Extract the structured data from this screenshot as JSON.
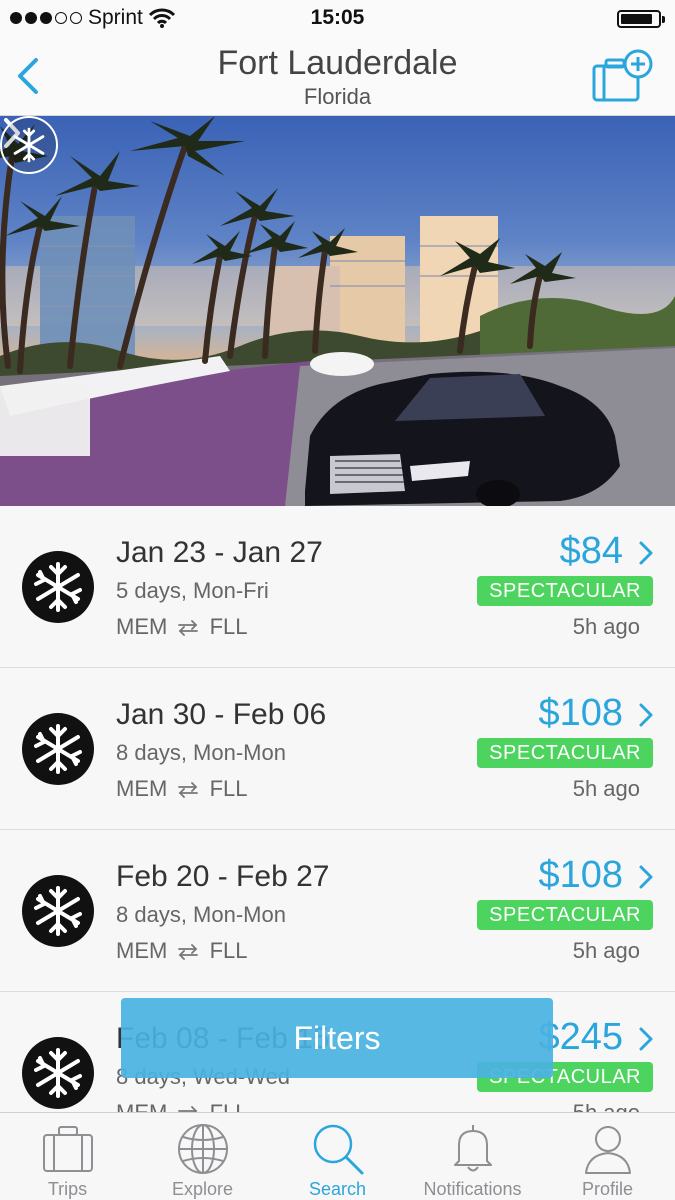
{
  "status_bar": {
    "carrier": "Sprint",
    "signal_bars_filled": 3,
    "signal_bars_total": 5,
    "time": "15:05",
    "battery_level": 0.85
  },
  "nav": {
    "title": "Fort Lauderdale",
    "subtitle": "Florida",
    "back_icon": "chevron-left-icon",
    "add_icon": "add-trip-icon"
  },
  "hero": {
    "next_icon": "chevron-right-icon",
    "badge_icon": "snowflake-plane-icon"
  },
  "deals": [
    {
      "dates": "Jan 23 - Jan 27",
      "duration": "5 days, Mon-Fri",
      "route_from": "MEM",
      "route_to": "FLL",
      "price": "$84",
      "tag": "SPECTACULAR",
      "time": "5h ago"
    },
    {
      "dates": "Jan 30 - Feb 06",
      "duration": "8 days, Mon-Mon",
      "route_from": "MEM",
      "route_to": "FLL",
      "price": "$108",
      "tag": "SPECTACULAR",
      "time": "5h ago"
    },
    {
      "dates": "Feb 20 - Feb 27",
      "duration": "8 days, Mon-Mon",
      "route_from": "MEM",
      "route_to": "FLL",
      "price": "$108",
      "tag": "SPECTACULAR",
      "time": "5h ago"
    },
    {
      "dates": "Feb 08 - Feb 15",
      "duration": "8 days, Wed-Wed",
      "route_from": "MEM",
      "route_to": "FLL",
      "price": "$245",
      "tag": "SPECTACULAR",
      "time": "5h ago"
    }
  ],
  "filters_label": "Filters",
  "tabs": [
    {
      "label": "Trips",
      "icon": "suitcase-icon",
      "active": false
    },
    {
      "label": "Explore",
      "icon": "globe-icon",
      "active": false
    },
    {
      "label": "Search",
      "icon": "search-icon",
      "active": true
    },
    {
      "label": "Notifications",
      "icon": "bell-icon",
      "active": false
    },
    {
      "label": "Profile",
      "icon": "profile-icon",
      "active": false
    }
  ],
  "colors": {
    "accent": "#2aa6dc",
    "tag_green": "#4cd45e",
    "filters_blue": "#4ab2e2"
  }
}
